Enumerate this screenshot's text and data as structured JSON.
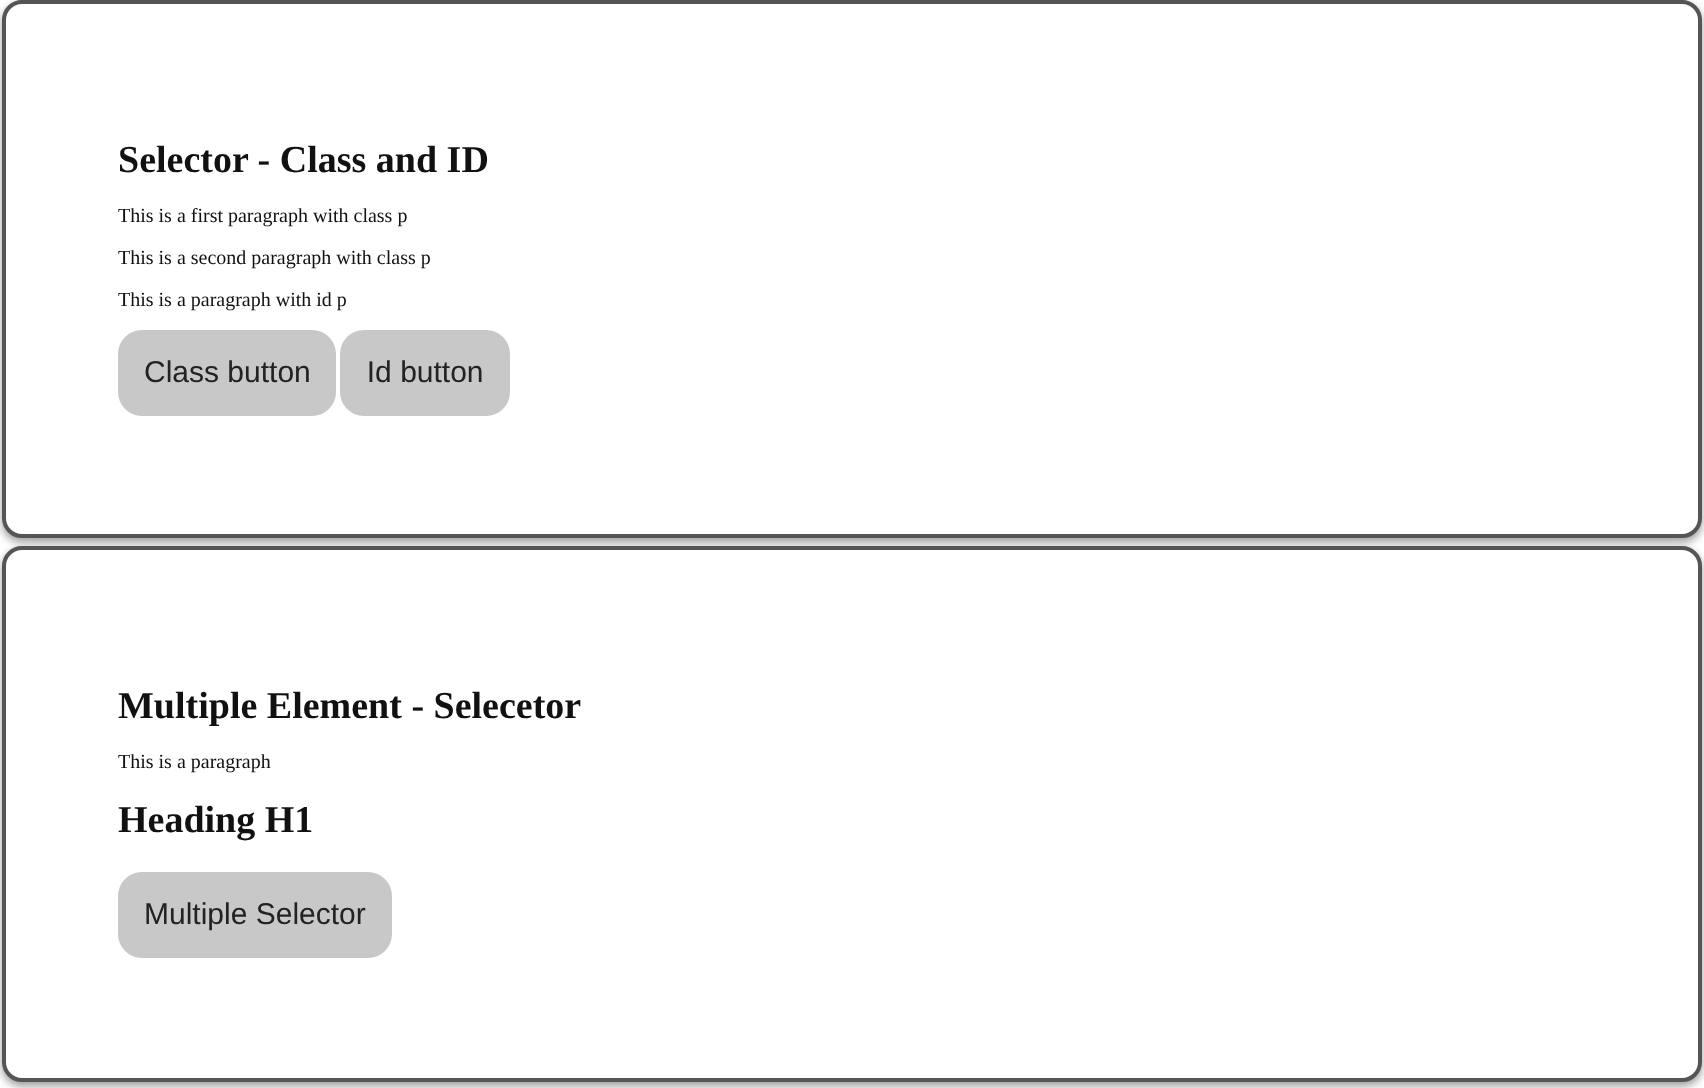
{
  "cards": [
    {
      "title": "Selector - Class and ID",
      "blocks": [
        {
          "kind": "paragraph",
          "text": "This is a first paragraph with class p"
        },
        {
          "kind": "paragraph",
          "text": "This is a second paragraph with class p"
        },
        {
          "kind": "paragraph",
          "text": "This is a paragraph with id p"
        },
        {
          "kind": "buttons",
          "labels": [
            "Class button",
            "Id button"
          ]
        }
      ]
    },
    {
      "title": "Multiple Element - Selecetor",
      "blocks": [
        {
          "kind": "paragraph",
          "text": "This is a paragraph"
        },
        {
          "kind": "heading",
          "text": "Heading H1"
        },
        {
          "kind": "buttons",
          "labels": [
            "Multiple Selector"
          ]
        }
      ]
    }
  ]
}
